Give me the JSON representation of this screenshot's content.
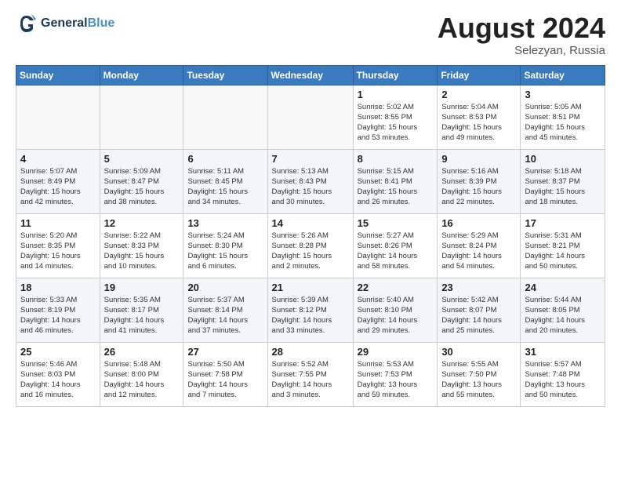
{
  "logo": {
    "line1": "General",
    "line2": "Blue"
  },
  "title": "August 2024",
  "location": "Selezyan, Russia",
  "days_header": [
    "Sunday",
    "Monday",
    "Tuesday",
    "Wednesday",
    "Thursday",
    "Friday",
    "Saturday"
  ],
  "weeks": [
    [
      {
        "day": "",
        "info": ""
      },
      {
        "day": "",
        "info": ""
      },
      {
        "day": "",
        "info": ""
      },
      {
        "day": "",
        "info": ""
      },
      {
        "day": "1",
        "info": "Sunrise: 5:02 AM\nSunset: 8:55 PM\nDaylight: 15 hours\nand 53 minutes."
      },
      {
        "day": "2",
        "info": "Sunrise: 5:04 AM\nSunset: 8:53 PM\nDaylight: 15 hours\nand 49 minutes."
      },
      {
        "day": "3",
        "info": "Sunrise: 5:05 AM\nSunset: 8:51 PM\nDaylight: 15 hours\nand 45 minutes."
      }
    ],
    [
      {
        "day": "4",
        "info": "Sunrise: 5:07 AM\nSunset: 8:49 PM\nDaylight: 15 hours\nand 42 minutes."
      },
      {
        "day": "5",
        "info": "Sunrise: 5:09 AM\nSunset: 8:47 PM\nDaylight: 15 hours\nand 38 minutes."
      },
      {
        "day": "6",
        "info": "Sunrise: 5:11 AM\nSunset: 8:45 PM\nDaylight: 15 hours\nand 34 minutes."
      },
      {
        "day": "7",
        "info": "Sunrise: 5:13 AM\nSunset: 8:43 PM\nDaylight: 15 hours\nand 30 minutes."
      },
      {
        "day": "8",
        "info": "Sunrise: 5:15 AM\nSunset: 8:41 PM\nDaylight: 15 hours\nand 26 minutes."
      },
      {
        "day": "9",
        "info": "Sunrise: 5:16 AM\nSunset: 8:39 PM\nDaylight: 15 hours\nand 22 minutes."
      },
      {
        "day": "10",
        "info": "Sunrise: 5:18 AM\nSunset: 8:37 PM\nDaylight: 15 hours\nand 18 minutes."
      }
    ],
    [
      {
        "day": "11",
        "info": "Sunrise: 5:20 AM\nSunset: 8:35 PM\nDaylight: 15 hours\nand 14 minutes."
      },
      {
        "day": "12",
        "info": "Sunrise: 5:22 AM\nSunset: 8:33 PM\nDaylight: 15 hours\nand 10 minutes."
      },
      {
        "day": "13",
        "info": "Sunrise: 5:24 AM\nSunset: 8:30 PM\nDaylight: 15 hours\nand 6 minutes."
      },
      {
        "day": "14",
        "info": "Sunrise: 5:26 AM\nSunset: 8:28 PM\nDaylight: 15 hours\nand 2 minutes."
      },
      {
        "day": "15",
        "info": "Sunrise: 5:27 AM\nSunset: 8:26 PM\nDaylight: 14 hours\nand 58 minutes."
      },
      {
        "day": "16",
        "info": "Sunrise: 5:29 AM\nSunset: 8:24 PM\nDaylight: 14 hours\nand 54 minutes."
      },
      {
        "day": "17",
        "info": "Sunrise: 5:31 AM\nSunset: 8:21 PM\nDaylight: 14 hours\nand 50 minutes."
      }
    ],
    [
      {
        "day": "18",
        "info": "Sunrise: 5:33 AM\nSunset: 8:19 PM\nDaylight: 14 hours\nand 46 minutes."
      },
      {
        "day": "19",
        "info": "Sunrise: 5:35 AM\nSunset: 8:17 PM\nDaylight: 14 hours\nand 41 minutes."
      },
      {
        "day": "20",
        "info": "Sunrise: 5:37 AM\nSunset: 8:14 PM\nDaylight: 14 hours\nand 37 minutes."
      },
      {
        "day": "21",
        "info": "Sunrise: 5:39 AM\nSunset: 8:12 PM\nDaylight: 14 hours\nand 33 minutes."
      },
      {
        "day": "22",
        "info": "Sunrise: 5:40 AM\nSunset: 8:10 PM\nDaylight: 14 hours\nand 29 minutes."
      },
      {
        "day": "23",
        "info": "Sunrise: 5:42 AM\nSunset: 8:07 PM\nDaylight: 14 hours\nand 25 minutes."
      },
      {
        "day": "24",
        "info": "Sunrise: 5:44 AM\nSunset: 8:05 PM\nDaylight: 14 hours\nand 20 minutes."
      }
    ],
    [
      {
        "day": "25",
        "info": "Sunrise: 5:46 AM\nSunset: 8:03 PM\nDaylight: 14 hours\nand 16 minutes."
      },
      {
        "day": "26",
        "info": "Sunrise: 5:48 AM\nSunset: 8:00 PM\nDaylight: 14 hours\nand 12 minutes."
      },
      {
        "day": "27",
        "info": "Sunrise: 5:50 AM\nSunset: 7:58 PM\nDaylight: 14 hours\nand 7 minutes."
      },
      {
        "day": "28",
        "info": "Sunrise: 5:52 AM\nSunset: 7:55 PM\nDaylight: 14 hours\nand 3 minutes."
      },
      {
        "day": "29",
        "info": "Sunrise: 5:53 AM\nSunset: 7:53 PM\nDaylight: 13 hours\nand 59 minutes."
      },
      {
        "day": "30",
        "info": "Sunrise: 5:55 AM\nSunset: 7:50 PM\nDaylight: 13 hours\nand 55 minutes."
      },
      {
        "day": "31",
        "info": "Sunrise: 5:57 AM\nSunset: 7:48 PM\nDaylight: 13 hours\nand 50 minutes."
      }
    ]
  ]
}
